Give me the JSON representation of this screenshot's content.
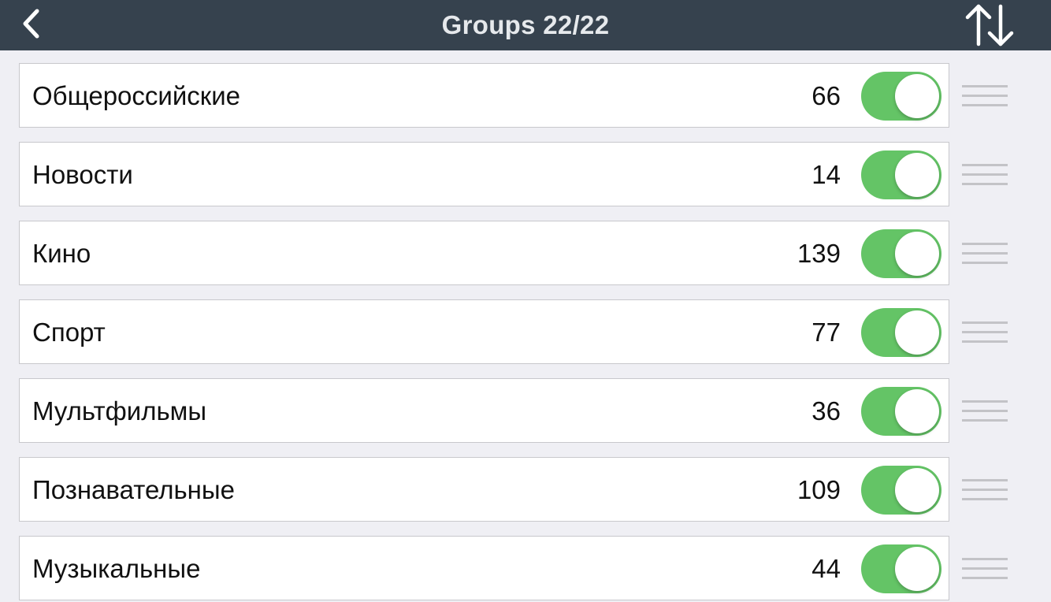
{
  "header": {
    "title": "Groups 22/22",
    "back_icon": "chevron-left-icon",
    "sort_icon": "sort-arrows-icon"
  },
  "colors": {
    "navbar": "#36424e",
    "toggle_on": "#64c466",
    "background": "#efeff4"
  },
  "groups": [
    {
      "name": "Общероссийские",
      "count": "66",
      "enabled": true
    },
    {
      "name": "Новости",
      "count": "14",
      "enabled": true
    },
    {
      "name": "Кино",
      "count": "139",
      "enabled": true
    },
    {
      "name": "Спорт",
      "count": "77",
      "enabled": true
    },
    {
      "name": "Мультфильмы",
      "count": "36",
      "enabled": true
    },
    {
      "name": "Познавательные",
      "count": "109",
      "enabled": true
    },
    {
      "name": "Музыкальные",
      "count": "44",
      "enabled": true
    }
  ]
}
